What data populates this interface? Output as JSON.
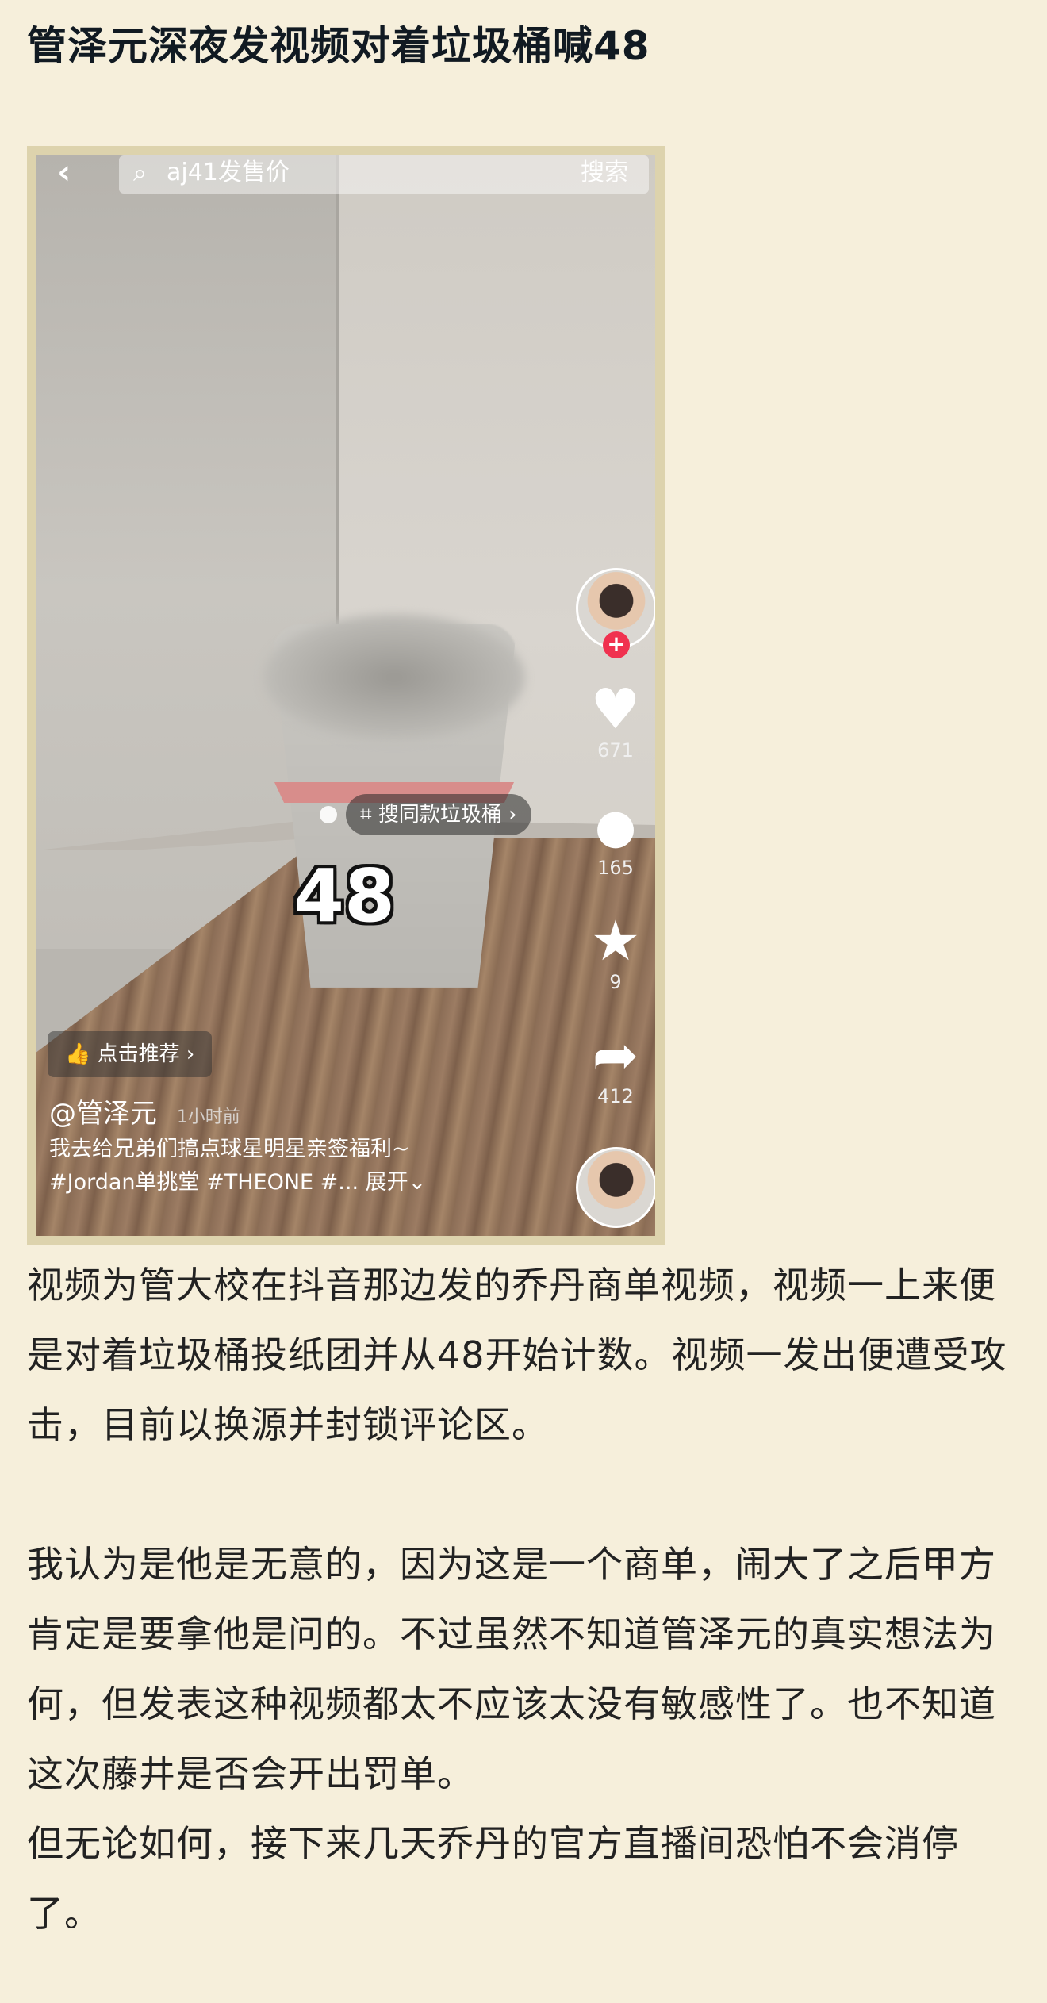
{
  "article": {
    "title": "管泽元深夜发视频对着垃圾桶喊48",
    "paragraphs": [
      "视频为管大校在抖音那边发的乔丹商单视频，视频一上来便是对着垃圾桶投纸团并从48开始计数。视频一发出便遭受攻击，目前以换源并封锁评论区。",
      "我认为是他是无意的，因为这是一个商单，闹大了之后甲方肯定是要拿他是问的。不过虽然不知道管泽元的真实想法为何，但发表这种视频都太不应该太没有敏感性了。也不知道这次藤井是否会开出罚单。",
      "但无论如何，接下来几天乔丹的官方直播间恐怕不会消停了。"
    ]
  },
  "video": {
    "back_icon": "chevron-left-icon",
    "search_placeholder": "aj41发售价",
    "search_button": "搜索",
    "tag_label": "搜同款垃圾桶 ›",
    "overlay_number": "48",
    "rail": {
      "likes": "671",
      "comments": "165",
      "favorites": "9",
      "shares": "412"
    },
    "recommend_label": "点击推荐 ›",
    "author_handle": "@管泽元",
    "time_ago": "1小时前",
    "caption_line1": "我去给兄弟们搞点球星明星亲签福利~",
    "caption_line2": "#Jordan单挑堂 #THEONE #... 展开⌄"
  },
  "colors": {
    "page_bg": "#f6efdb",
    "frame": "#ddd3ad",
    "accent_red": "#f0314f"
  }
}
